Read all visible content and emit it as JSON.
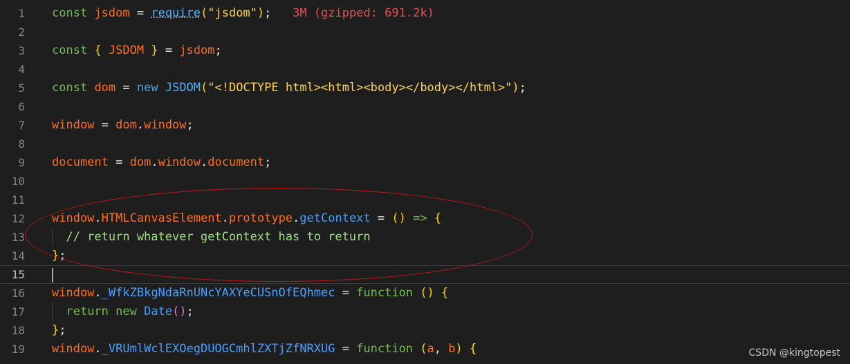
{
  "lines": [
    {
      "n": "1",
      "segments": [
        {
          "t": "const",
          "c": "kw2"
        },
        {
          "t": " ",
          "c": "punc"
        },
        {
          "t": "jsdom",
          "c": "var"
        },
        {
          "t": " = ",
          "c": "punc"
        },
        {
          "t": "require",
          "c": "fn squig"
        },
        {
          "t": "(",
          "c": "br1"
        },
        {
          "t": "\"jsdom\"",
          "c": "str"
        },
        {
          "t": ")",
          "c": "br1"
        },
        {
          "t": ";",
          "c": "punc"
        },
        {
          "t": "   3M (gzipped: 691.2k)",
          "c": "hint"
        }
      ]
    },
    {
      "n": "2",
      "segments": []
    },
    {
      "n": "3",
      "segments": [
        {
          "t": "const",
          "c": "kw2"
        },
        {
          "t": " ",
          "c": "punc"
        },
        {
          "t": "{",
          "c": "br1"
        },
        {
          "t": " JSDOM ",
          "c": "var"
        },
        {
          "t": "}",
          "c": "br1"
        },
        {
          "t": " = ",
          "c": "punc"
        },
        {
          "t": "jsdom",
          "c": "var"
        },
        {
          "t": ";",
          "c": "punc"
        }
      ]
    },
    {
      "n": "4",
      "segments": []
    },
    {
      "n": "5",
      "segments": [
        {
          "t": "const",
          "c": "kw2"
        },
        {
          "t": " ",
          "c": "punc"
        },
        {
          "t": "dom",
          "c": "var"
        },
        {
          "t": " = ",
          "c": "punc"
        },
        {
          "t": "new",
          "c": "kw"
        },
        {
          "t": " ",
          "c": "punc"
        },
        {
          "t": "JSDOM",
          "c": "fn"
        },
        {
          "t": "(",
          "c": "br1"
        },
        {
          "t": "\"<!DOCTYPE html><html><body></body></html>\"",
          "c": "str"
        },
        {
          "t": ")",
          "c": "br1"
        },
        {
          "t": ";",
          "c": "punc"
        }
      ]
    },
    {
      "n": "6",
      "segments": []
    },
    {
      "n": "7",
      "segments": [
        {
          "t": "window",
          "c": "var"
        },
        {
          "t": " = ",
          "c": "punc"
        },
        {
          "t": "dom",
          "c": "var"
        },
        {
          "t": ".",
          "c": "punc"
        },
        {
          "t": "window",
          "c": "var"
        },
        {
          "t": ";",
          "c": "punc"
        }
      ]
    },
    {
      "n": "8",
      "segments": []
    },
    {
      "n": "9",
      "segments": [
        {
          "t": "document",
          "c": "var"
        },
        {
          "t": " = ",
          "c": "punc"
        },
        {
          "t": "dom",
          "c": "var"
        },
        {
          "t": ".",
          "c": "punc"
        },
        {
          "t": "window",
          "c": "var"
        },
        {
          "t": ".",
          "c": "punc"
        },
        {
          "t": "document",
          "c": "var"
        },
        {
          "t": ";",
          "c": "punc"
        }
      ]
    },
    {
      "n": "10",
      "segments": []
    },
    {
      "n": "11",
      "segments": []
    },
    {
      "n": "12",
      "segments": [
        {
          "t": "window",
          "c": "var"
        },
        {
          "t": ".",
          "c": "punc"
        },
        {
          "t": "HTMLCanvasElement",
          "c": "var"
        },
        {
          "t": ".",
          "c": "punc"
        },
        {
          "t": "prototype",
          "c": "var"
        },
        {
          "t": ".",
          "c": "punc"
        },
        {
          "t": "getContext",
          "c": "blue"
        },
        {
          "t": " = ",
          "c": "punc"
        },
        {
          "t": "()",
          "c": "br1"
        },
        {
          "t": " ",
          "c": "punc"
        },
        {
          "t": "=>",
          "c": "kw2"
        },
        {
          "t": " ",
          "c": "punc"
        },
        {
          "t": "{",
          "c": "br1"
        }
      ]
    },
    {
      "n": "13",
      "segments": [
        {
          "t": "  // return whatever getContext has to return",
          "c": "cm"
        }
      ]
    },
    {
      "n": "14",
      "segments": [
        {
          "t": "}",
          "c": "br1"
        },
        {
          "t": ";",
          "c": "punc"
        }
      ]
    },
    {
      "n": "15",
      "segments": []
    },
    {
      "n": "16",
      "segments": [
        {
          "t": "window",
          "c": "var"
        },
        {
          "t": ".",
          "c": "punc"
        },
        {
          "t": "_WfkZBkgNdaRnUNcYAXYeCUSnOfEQhmec",
          "c": "blue"
        },
        {
          "t": " = ",
          "c": "punc"
        },
        {
          "t": "function",
          "c": "kw2"
        },
        {
          "t": " ",
          "c": "punc"
        },
        {
          "t": "()",
          "c": "br1"
        },
        {
          "t": " ",
          "c": "punc"
        },
        {
          "t": "{",
          "c": "br1"
        }
      ]
    },
    {
      "n": "17",
      "segments": [
        {
          "t": "  ",
          "c": "punc"
        },
        {
          "t": "return",
          "c": "kw2"
        },
        {
          "t": " ",
          "c": "punc"
        },
        {
          "t": "new",
          "c": "kw2"
        },
        {
          "t": " ",
          "c": "punc"
        },
        {
          "t": "Date",
          "c": "blue"
        },
        {
          "t": "()",
          "c": "br2"
        },
        {
          "t": ";",
          "c": "punc"
        }
      ]
    },
    {
      "n": "18",
      "segments": [
        {
          "t": "}",
          "c": "br1"
        },
        {
          "t": ";",
          "c": "punc"
        }
      ]
    },
    {
      "n": "19",
      "segments": [
        {
          "t": "window",
          "c": "var"
        },
        {
          "t": ".",
          "c": "punc"
        },
        {
          "t": "_VRUmlWclEXOegDUOGCmhlZXTjZfNRXUG",
          "c": "blue"
        },
        {
          "t": " = ",
          "c": "punc"
        },
        {
          "t": "function",
          "c": "kw2"
        },
        {
          "t": " ",
          "c": "punc"
        },
        {
          "t": "(",
          "c": "br1"
        },
        {
          "t": "a",
          "c": "var"
        },
        {
          "t": ", ",
          "c": "punc"
        },
        {
          "t": "b",
          "c": "var"
        },
        {
          "t": ")",
          "c": "br1"
        },
        {
          "t": " ",
          "c": "punc"
        },
        {
          "t": "{",
          "c": "br1"
        }
      ]
    }
  ],
  "current_line": "15",
  "watermark": "CSDN @kingtopest"
}
